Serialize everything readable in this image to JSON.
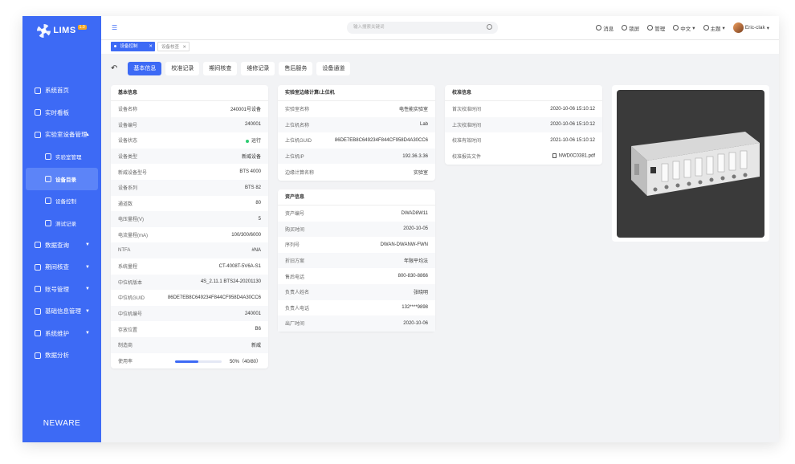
{
  "app": {
    "logo": "LIMS",
    "logo_badge": "1.0",
    "brand": "NEWARE"
  },
  "sidebar": {
    "items": [
      {
        "label": "系统首页"
      },
      {
        "label": "实时看板"
      },
      {
        "label": "实验室设备管理"
      },
      {
        "label": "实验室管理"
      },
      {
        "label": "设备目录"
      },
      {
        "label": "设备控制"
      },
      {
        "label": "测试记录"
      },
      {
        "label": "数据查询"
      },
      {
        "label": "期间核查"
      },
      {
        "label": "账号管理"
      },
      {
        "label": "基础信息管理"
      },
      {
        "label": "系统维护"
      },
      {
        "label": "数据分析"
      }
    ]
  },
  "topbar": {
    "search_placeholder": "输入搜索关键词",
    "messages": "消息",
    "lock": "锁屏",
    "admin": "管理",
    "language": "中文",
    "theme": "主题",
    "user": "Eric-clak"
  },
  "tags": [
    {
      "label": "设备控制"
    },
    {
      "label": "设备核查"
    }
  ],
  "tabs": [
    {
      "label": "基本信息"
    },
    {
      "label": "校准记录"
    },
    {
      "label": "期间核查"
    },
    {
      "label": "维修记录"
    },
    {
      "label": "售后服务"
    },
    {
      "label": "设备通道"
    }
  ],
  "basic": {
    "title": "基本信息",
    "rows": [
      {
        "k": "设备名称",
        "v": "240001号设备"
      },
      {
        "k": "设备编号",
        "v": "240001"
      },
      {
        "k": "设备状态",
        "v": "运行"
      },
      {
        "k": "设备类型",
        "v": "新威设备"
      },
      {
        "k": "新威设备型号",
        "v": "BTS 4000"
      },
      {
        "k": "设备系列",
        "v": "BTS 82"
      },
      {
        "k": "通道数",
        "v": "80"
      },
      {
        "k": "电压量程(V)",
        "v": "5"
      },
      {
        "k": "电流量程(mA)",
        "v": "100/300/6000"
      },
      {
        "k": "NTFA",
        "v": "#NA"
      },
      {
        "k": "系统量程",
        "v": "CT-4008T-5V6A-S1"
      },
      {
        "k": "中位机版本",
        "v": "4S_2.11.1 BTS24-20201130"
      },
      {
        "k": "中位机GUID",
        "v": "86DE7EB8C649234F844CF958D4A30CC6"
      },
      {
        "k": "中位机编号",
        "v": "240001"
      },
      {
        "k": "存放位置",
        "v": "B6"
      },
      {
        "k": "制造商",
        "v": "新威"
      }
    ],
    "usage_label": "使用率",
    "usage_text": "50%（40/80）",
    "usage_fraction": 0.5
  },
  "lab": {
    "title": "实验室边缘计算/上位机",
    "rows": [
      {
        "k": "实验室名称",
        "v": "电性能实验室"
      },
      {
        "k": "上位机名称",
        "v": "Lab"
      },
      {
        "k": "上位机GUID",
        "v": "86DE7EB8C649234F844CF958D4A30CC6"
      },
      {
        "k": "上位机IP",
        "v": "192.36.3.36"
      },
      {
        "k": "边缘计算名称",
        "v": "实验室"
      }
    ]
  },
  "asset": {
    "title": "资产信息",
    "rows": [
      {
        "k": "资产编号",
        "v": "DWAD8W11"
      },
      {
        "k": "购买时间",
        "v": "2020-10-05"
      },
      {
        "k": "序列号",
        "v": "DWAN-DWANW-FWN"
      },
      {
        "k": "折旧方案",
        "v": "年限平均法"
      },
      {
        "k": "售后电话",
        "v": "800-830-8866"
      },
      {
        "k": "负责人姓名",
        "v": "张晓明"
      },
      {
        "k": "负责人电话",
        "v": "132****9898"
      },
      {
        "k": "出厂时间",
        "v": "2020-10-06"
      }
    ]
  },
  "calib": {
    "title": "校准信息",
    "rows": [
      {
        "k": "首次校准时间",
        "v": "2020-10-06  15:10:12"
      },
      {
        "k": "上次校准时间",
        "v": "2020-10-06  15:10:12"
      },
      {
        "k": "校准有效时间",
        "v": "2021-10-06  15:10:12"
      }
    ],
    "file_label": "校准报告文件",
    "file_name": "NWD0C0381.pdf"
  },
  "colors": {
    "accent": "#3d6af5",
    "running": "#2ecc71"
  }
}
